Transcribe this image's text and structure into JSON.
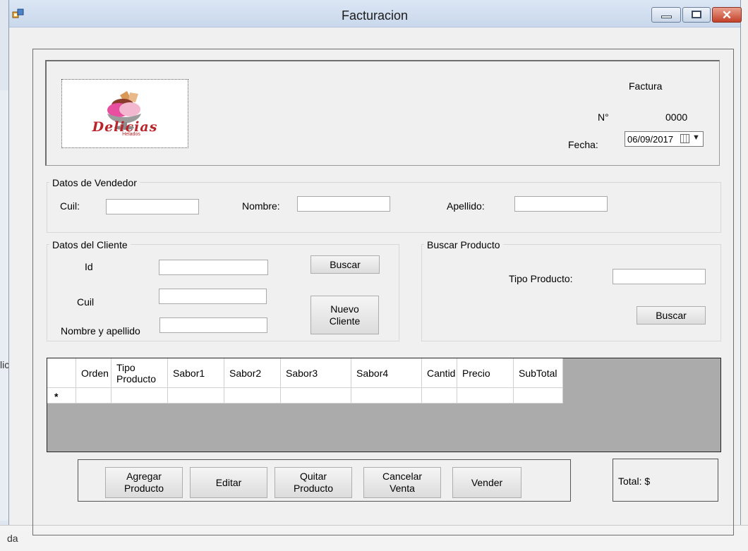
{
  "background": {
    "left_text": "lic",
    "bottom_text": "da"
  },
  "window": {
    "title": "Facturacion",
    "controls": {
      "close_glyph": "✕"
    }
  },
  "header": {
    "logo": {
      "brand": "Delicias",
      "subtitle": "Helados"
    },
    "factura_label": "Factura",
    "numero_label": "N°",
    "numero_value": "0000",
    "fecha_label": "Fecha:",
    "fecha_value": "06/09/2017"
  },
  "vendedor": {
    "group_title": "Datos de Vendedor",
    "cuil_label": "Cuil:",
    "cuil_value": "",
    "nombre_label": "Nombre:",
    "nombre_value": "",
    "apellido_label": "Apellido:",
    "apellido_value": ""
  },
  "cliente": {
    "group_title": "Datos del Cliente",
    "id_label": "Id",
    "id_value": "",
    "cuil_label": "Cuil",
    "cuil_value": "",
    "nombre_label": "Nombre y apellido",
    "nombre_value": "",
    "buscar_label": "Buscar",
    "nuevo_line1": "Nuevo",
    "nuevo_line2": "Cliente"
  },
  "producto": {
    "group_title": "Buscar Producto",
    "tipo_label": "Tipo Producto:",
    "tipo_value": "",
    "buscar_label": "Buscar"
  },
  "grid": {
    "columns": [
      "Orden",
      "Tipo\nProducto",
      "Sabor1",
      "Sabor2",
      "Sabor3",
      "Sabor4",
      "Cantid",
      "Precio",
      "SubTotal"
    ],
    "new_row_marker": "*"
  },
  "actions": {
    "agregar_line1": "Agregar",
    "agregar_line2": "Producto",
    "editar": "Editar",
    "quitar_line1": "Quitar",
    "quitar_line2": "Producto",
    "cancelar_line1": "Cancelar",
    "cancelar_line2": "Venta",
    "vender": "Vender"
  },
  "total": {
    "label": "Total: $"
  }
}
